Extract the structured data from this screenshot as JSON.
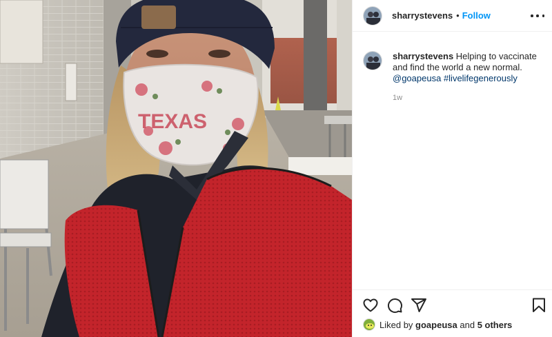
{
  "post": {
    "photo_alt": "",
    "author": {
      "username": "sharrystevens",
      "separator": "•",
      "follow_label": "Follow"
    },
    "caption": {
      "username": "sharrystevens",
      "text": "Helping to vaccinate and find the world a new normal.",
      "mention": "@goapeusa",
      "hashtag": "#livelifegenerously",
      "time_ago": "1w"
    },
    "likes": {
      "prefix": "Liked by",
      "first_user": "goapeusa",
      "and": "and",
      "others": "5 others"
    },
    "icons": {
      "like": "heart-icon",
      "comment": "comment-icon",
      "share": "paper-plane-icon",
      "save": "bookmark-icon",
      "more": "more-options-icon"
    },
    "colors": {
      "follow_blue": "#0095f6",
      "link_blue": "#00376b",
      "muted": "#8e8e8e",
      "vest_red": "#c3242b"
    }
  }
}
